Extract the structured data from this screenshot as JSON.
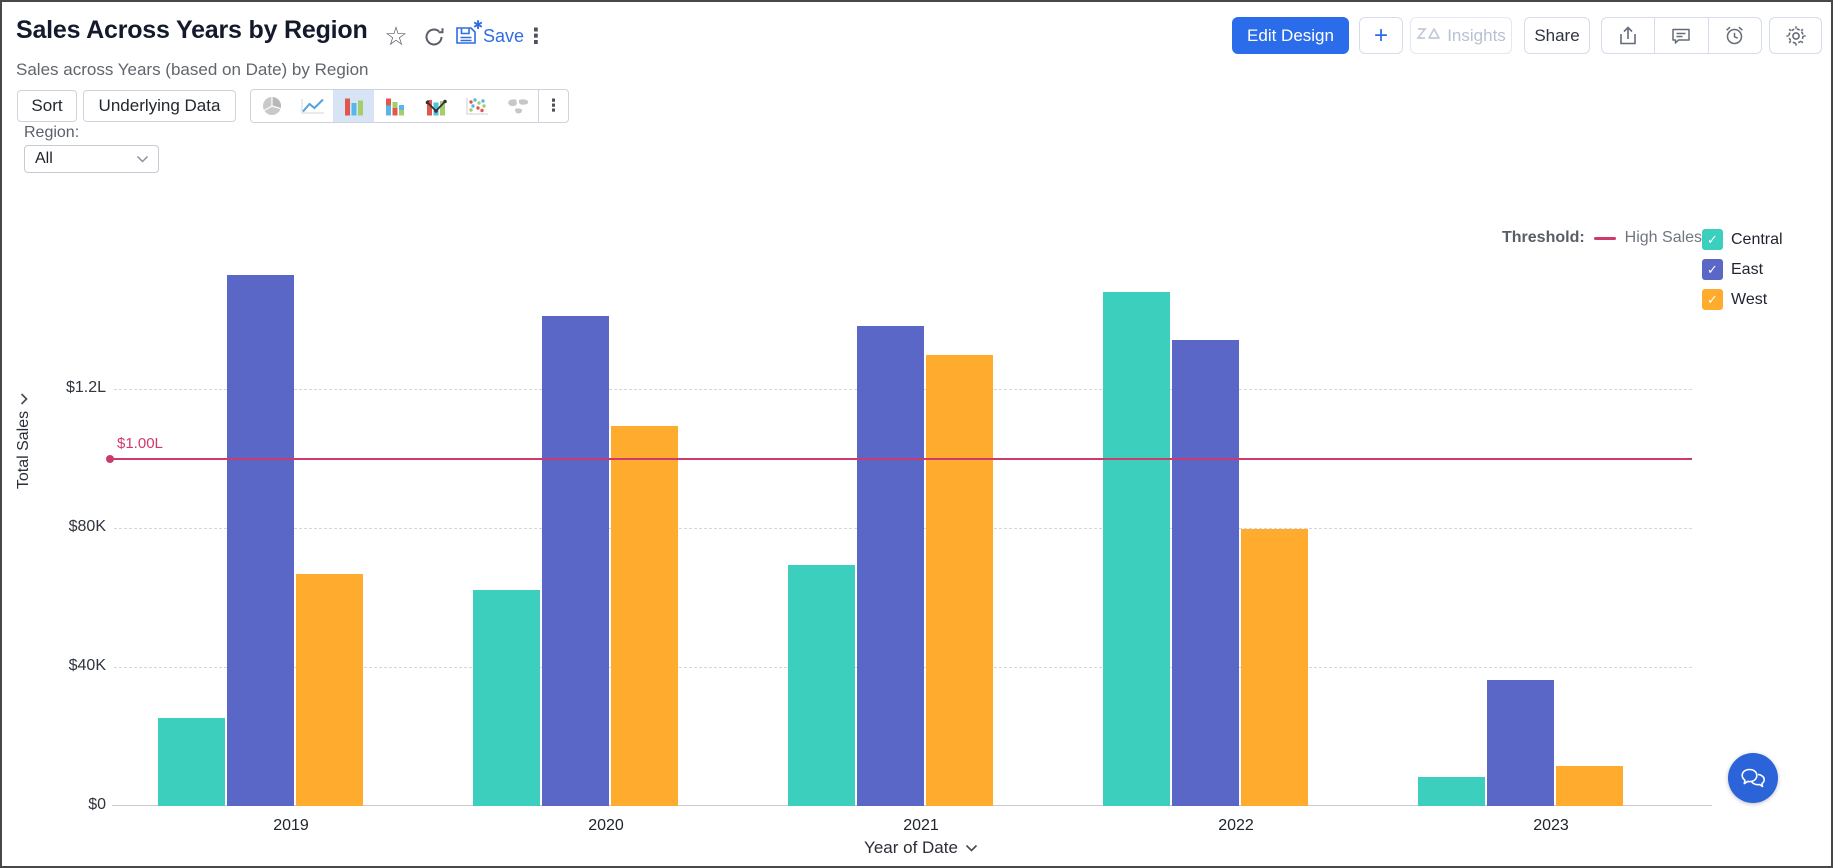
{
  "header": {
    "title": "Sales Across Years by Region",
    "subtitle": "Sales across Years (based on Date) by Region",
    "save_label": "Save",
    "buttons": {
      "edit_design": "Edit Design",
      "plus": "+",
      "insights": "Insights",
      "share": "Share"
    }
  },
  "toolbar": {
    "sort_label": "Sort",
    "underlying_data_label": "Underlying Data",
    "chart_types": [
      {
        "name": "pie-chart",
        "selected": false
      },
      {
        "name": "line-chart",
        "selected": false
      },
      {
        "name": "bar-chart",
        "selected": true
      },
      {
        "name": "stacked-bar-chart",
        "selected": false
      },
      {
        "name": "bar-line-chart",
        "selected": false
      },
      {
        "name": "scatter-chart",
        "selected": false
      },
      {
        "name": "map-chart",
        "selected": false
      }
    ],
    "more_chart_types": "⋮"
  },
  "filter": {
    "label": "Region:",
    "value": "All"
  },
  "icons": {
    "star": "☆",
    "more_vertical": "⋮",
    "check": "✓"
  },
  "chart_data": {
    "type": "bar",
    "title": "Sales Across Years by Region",
    "categories": [
      "2019",
      "2020",
      "2021",
      "2022",
      "2023"
    ],
    "series": [
      {
        "name": "Central",
        "color": "#3ccfbd",
        "values": [
          25300,
          62200,
          69400,
          147900,
          8300
        ]
      },
      {
        "name": "East",
        "color": "#5b67c7",
        "values": [
          152800,
          141000,
          138200,
          134100,
          36300
        ]
      },
      {
        "name": "West",
        "color": "#ffab2e",
        "values": [
          66800,
          109400,
          129800,
          79700,
          11500
        ]
      }
    ],
    "xlabel": "Year of Date",
    "ylabel": "Total Sales",
    "yticks": [
      {
        "label": "$0",
        "value": 0
      },
      {
        "label": "$40K",
        "value": 40000
      },
      {
        "label": "$80K",
        "value": 80000
      },
      {
        "label": "$1.2L",
        "value": 120000
      }
    ],
    "ylim": [
      0,
      175000
    ],
    "grid": "dashed-horizontal",
    "legend_position": "top-right",
    "threshold": {
      "legend_title": "Threshold:",
      "name": "High Sales",
      "value": 100000,
      "value_label": "$1.00L",
      "color": "#cd3a6c"
    }
  }
}
